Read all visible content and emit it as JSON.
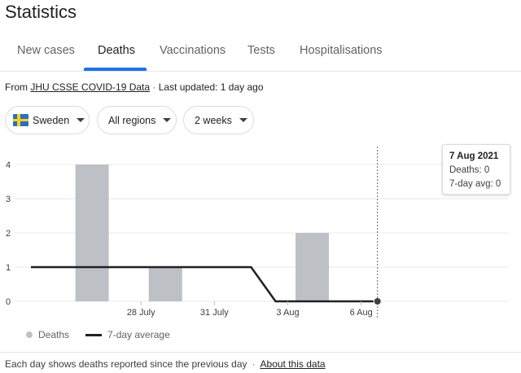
{
  "page": {
    "title": "Statistics"
  },
  "tabs": [
    {
      "label": "New cases",
      "active": false
    },
    {
      "label": "Deaths",
      "active": true
    },
    {
      "label": "Vaccinations",
      "active": false
    },
    {
      "label": "Tests",
      "active": false
    },
    {
      "label": "Hospitalisations",
      "active": false
    }
  ],
  "source": {
    "prefix": "From ",
    "link": "JHU CSSE COVID-19 Data",
    "separator": " · ",
    "updated": "Last updated: 1 day ago"
  },
  "filters": {
    "country": {
      "label": "Sweden",
      "flag_icon": "sweden-flag-icon"
    },
    "region": {
      "label": "All regions"
    },
    "period": {
      "label": "2 weeks"
    }
  },
  "tooltip": {
    "date": "7 Aug 2021",
    "deaths": "Deaths: 0",
    "avg": "7-day avg: 0"
  },
  "legend": {
    "deaths": "Deaths",
    "average": "7-day average"
  },
  "footer": {
    "note": "Each day shows deaths reported since the previous day",
    "separator": "·",
    "link": "About this data"
  },
  "colors": {
    "bar": "#bdc1c6",
    "average_line": "#202124",
    "accent": "#1a73e8",
    "grid": "#e8eaed"
  },
  "chart_data": {
    "type": "bar",
    "x": [
      "24 Jul",
      "25 Jul",
      "26 Jul",
      "27 Jul",
      "28 Jul",
      "29 Jul",
      "30 Jul",
      "31 Jul",
      "1 Aug",
      "2 Aug",
      "3 Aug",
      "4 Aug",
      "5 Aug",
      "6 Aug",
      "7 Aug"
    ],
    "series": [
      {
        "name": "Deaths",
        "type": "bar",
        "values": [
          0,
          0,
          4,
          0,
          0,
          1,
          0,
          0,
          0,
          0,
          0,
          2,
          0,
          0,
          0
        ]
      },
      {
        "name": "7-day average",
        "type": "line",
        "values": [
          1,
          1,
          1,
          1,
          1,
          1,
          1,
          1,
          1,
          1,
          0,
          0,
          0,
          0,
          0
        ]
      }
    ],
    "x_ticks": [
      {
        "index": 4,
        "label": "28 July"
      },
      {
        "index": 7,
        "label": "31 July"
      },
      {
        "index": 10,
        "label": "3 Aug"
      },
      {
        "index": 13,
        "label": "6 Aug"
      }
    ],
    "y_ticks": [
      "0",
      "1",
      "2",
      "3",
      "4"
    ],
    "ylim": [
      0,
      4
    ],
    "grid": true,
    "highlight_index": 14
  }
}
